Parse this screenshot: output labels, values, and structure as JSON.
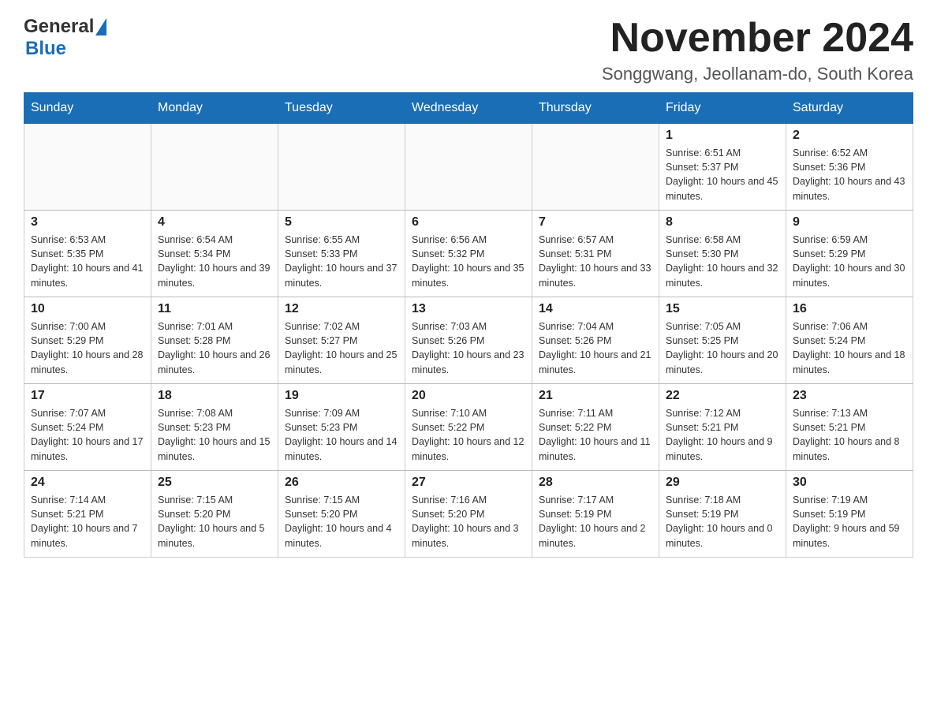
{
  "header": {
    "logo_general": "General",
    "logo_blue": "Blue",
    "title": "November 2024",
    "subtitle": "Songgwang, Jeollanam-do, South Korea"
  },
  "calendar": {
    "weekdays": [
      "Sunday",
      "Monday",
      "Tuesday",
      "Wednesday",
      "Thursday",
      "Friday",
      "Saturday"
    ],
    "weeks": [
      {
        "days": [
          {
            "date": "",
            "info": ""
          },
          {
            "date": "",
            "info": ""
          },
          {
            "date": "",
            "info": ""
          },
          {
            "date": "",
            "info": ""
          },
          {
            "date": "",
            "info": ""
          },
          {
            "date": "1",
            "info": "Sunrise: 6:51 AM\nSunset: 5:37 PM\nDaylight: 10 hours and 45 minutes."
          },
          {
            "date": "2",
            "info": "Sunrise: 6:52 AM\nSunset: 5:36 PM\nDaylight: 10 hours and 43 minutes."
          }
        ]
      },
      {
        "days": [
          {
            "date": "3",
            "info": "Sunrise: 6:53 AM\nSunset: 5:35 PM\nDaylight: 10 hours and 41 minutes."
          },
          {
            "date": "4",
            "info": "Sunrise: 6:54 AM\nSunset: 5:34 PM\nDaylight: 10 hours and 39 minutes."
          },
          {
            "date": "5",
            "info": "Sunrise: 6:55 AM\nSunset: 5:33 PM\nDaylight: 10 hours and 37 minutes."
          },
          {
            "date": "6",
            "info": "Sunrise: 6:56 AM\nSunset: 5:32 PM\nDaylight: 10 hours and 35 minutes."
          },
          {
            "date": "7",
            "info": "Sunrise: 6:57 AM\nSunset: 5:31 PM\nDaylight: 10 hours and 33 minutes."
          },
          {
            "date": "8",
            "info": "Sunrise: 6:58 AM\nSunset: 5:30 PM\nDaylight: 10 hours and 32 minutes."
          },
          {
            "date": "9",
            "info": "Sunrise: 6:59 AM\nSunset: 5:29 PM\nDaylight: 10 hours and 30 minutes."
          }
        ]
      },
      {
        "days": [
          {
            "date": "10",
            "info": "Sunrise: 7:00 AM\nSunset: 5:29 PM\nDaylight: 10 hours and 28 minutes."
          },
          {
            "date": "11",
            "info": "Sunrise: 7:01 AM\nSunset: 5:28 PM\nDaylight: 10 hours and 26 minutes."
          },
          {
            "date": "12",
            "info": "Sunrise: 7:02 AM\nSunset: 5:27 PM\nDaylight: 10 hours and 25 minutes."
          },
          {
            "date": "13",
            "info": "Sunrise: 7:03 AM\nSunset: 5:26 PM\nDaylight: 10 hours and 23 minutes."
          },
          {
            "date": "14",
            "info": "Sunrise: 7:04 AM\nSunset: 5:26 PM\nDaylight: 10 hours and 21 minutes."
          },
          {
            "date": "15",
            "info": "Sunrise: 7:05 AM\nSunset: 5:25 PM\nDaylight: 10 hours and 20 minutes."
          },
          {
            "date": "16",
            "info": "Sunrise: 7:06 AM\nSunset: 5:24 PM\nDaylight: 10 hours and 18 minutes."
          }
        ]
      },
      {
        "days": [
          {
            "date": "17",
            "info": "Sunrise: 7:07 AM\nSunset: 5:24 PM\nDaylight: 10 hours and 17 minutes."
          },
          {
            "date": "18",
            "info": "Sunrise: 7:08 AM\nSunset: 5:23 PM\nDaylight: 10 hours and 15 minutes."
          },
          {
            "date": "19",
            "info": "Sunrise: 7:09 AM\nSunset: 5:23 PM\nDaylight: 10 hours and 14 minutes."
          },
          {
            "date": "20",
            "info": "Sunrise: 7:10 AM\nSunset: 5:22 PM\nDaylight: 10 hours and 12 minutes."
          },
          {
            "date": "21",
            "info": "Sunrise: 7:11 AM\nSunset: 5:22 PM\nDaylight: 10 hours and 11 minutes."
          },
          {
            "date": "22",
            "info": "Sunrise: 7:12 AM\nSunset: 5:21 PM\nDaylight: 10 hours and 9 minutes."
          },
          {
            "date": "23",
            "info": "Sunrise: 7:13 AM\nSunset: 5:21 PM\nDaylight: 10 hours and 8 minutes."
          }
        ]
      },
      {
        "days": [
          {
            "date": "24",
            "info": "Sunrise: 7:14 AM\nSunset: 5:21 PM\nDaylight: 10 hours and 7 minutes."
          },
          {
            "date": "25",
            "info": "Sunrise: 7:15 AM\nSunset: 5:20 PM\nDaylight: 10 hours and 5 minutes."
          },
          {
            "date": "26",
            "info": "Sunrise: 7:15 AM\nSunset: 5:20 PM\nDaylight: 10 hours and 4 minutes."
          },
          {
            "date": "27",
            "info": "Sunrise: 7:16 AM\nSunset: 5:20 PM\nDaylight: 10 hours and 3 minutes."
          },
          {
            "date": "28",
            "info": "Sunrise: 7:17 AM\nSunset: 5:19 PM\nDaylight: 10 hours and 2 minutes."
          },
          {
            "date": "29",
            "info": "Sunrise: 7:18 AM\nSunset: 5:19 PM\nDaylight: 10 hours and 0 minutes."
          },
          {
            "date": "30",
            "info": "Sunrise: 7:19 AM\nSunset: 5:19 PM\nDaylight: 9 hours and 59 minutes."
          }
        ]
      }
    ]
  }
}
